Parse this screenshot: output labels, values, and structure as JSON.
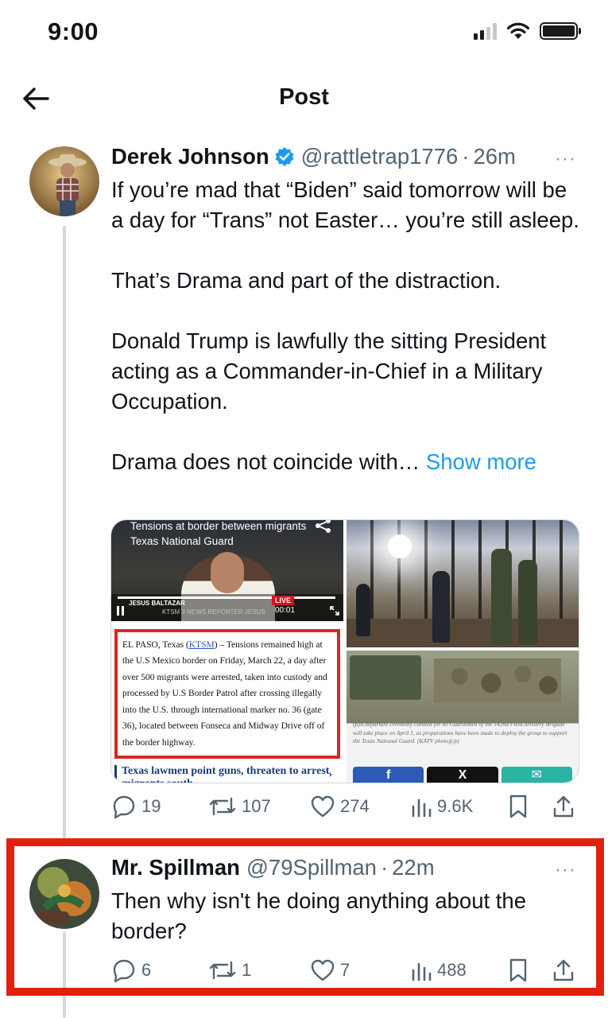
{
  "status_bar": {
    "time": "9:00"
  },
  "nav": {
    "title": "Post"
  },
  "main_tweet": {
    "name": "Derek Johnson",
    "handle": "@rattletrap1776",
    "separator": "·",
    "time": "26m",
    "more": "···",
    "text": {
      "p1": "If you’re mad that “Biden” said tomorrow will be a day for “Trans” not Easter… you’re still asleep.",
      "p2": "That’s Drama and part of the distraction.",
      "p3": "Donald Trump is lawfully the sitting President acting as a Commander-in-Chief in a Military Occupation.",
      "p4": "Drama does not coincide with…",
      "show_more": "Show more"
    },
    "media": {
      "video": {
        "caption_line1": "Tensions at border between migrants",
        "caption_line2": "Texas National Guard",
        "name_tag": "JESUS BALTAZAR",
        "subtitle": "KTSM 9 NEWS REPORTER JESUS",
        "live": "LIVE",
        "time": "00:01"
      },
      "article": {
        "text_before": "EL PASO, Texas (",
        "link": "KTSM",
        "text_after": ") – Tensions remained high at the U.S Mexico border on Friday, March 22, a day after over 500 migrants were arrested, taken into custody and processed by U.S Border Patrol after crossing illegally into the U.S. through international marker no. 36 (gate 36), located between Fonseca and Midway Drive off of the border highway.",
        "headline": "Texas lawmen point guns, threaten to arrest migrants south",
        "chevron": "›"
      },
      "photo_caption": "(p)A departure ceremony curated for 40 Guardsmen of the 142nd Field Artillery Brigade will take place on April 1, as preparations have been made to deploy the group to support the Texas National Guard. (KATV photo)(/p)",
      "share": {
        "facebook": "f",
        "x": "X",
        "email": "✉"
      }
    },
    "stats": {
      "replies": "19",
      "reposts": "107",
      "likes": "274",
      "views": "9.6K"
    }
  },
  "reply_tweet": {
    "name": "Mr. Spillman",
    "handle": "@79Spillman",
    "separator": "·",
    "time": "22m",
    "more": "···",
    "text_line1": "Then why isn't he doing anything about the",
    "text_line2": "border?",
    "stats": {
      "replies": "6",
      "reposts": "1",
      "likes": "7",
      "views": "488"
    }
  },
  "colors": {
    "accent": "#1d9bf0",
    "highlight": "#e0210e",
    "secondary_text": "#536471",
    "thread_line": "#cfd9de"
  },
  "icons": [
    "back-arrow-icon",
    "verified-badge-icon",
    "reply-icon",
    "repost-icon",
    "like-icon",
    "views-icon",
    "bookmark-icon",
    "share-icon",
    "more-icon",
    "signal-icon",
    "wifi-icon",
    "battery-icon"
  ]
}
